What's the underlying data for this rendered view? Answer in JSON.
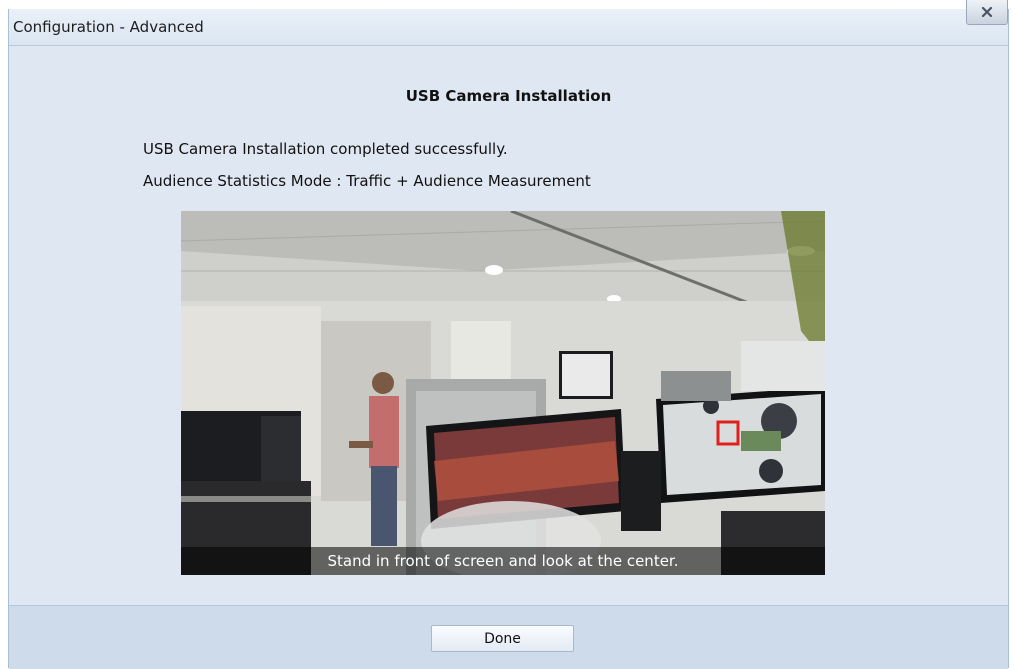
{
  "window": {
    "title": "Configuration - Advanced",
    "close_label": "x"
  },
  "content": {
    "heading": "USB Camera Installation",
    "status_message": "USB Camera Installation completed successfully.",
    "mode_message": "Audience Statistics Mode : Traffic + Audience Measurement"
  },
  "camera_preview": {
    "caption": "Stand in front of screen and look at the center."
  },
  "footer": {
    "done_label": "Done"
  },
  "colors": {
    "dialog_background": "#dfe8f2",
    "footer_background": "#cedbea",
    "detection_box": "#e0201c"
  }
}
